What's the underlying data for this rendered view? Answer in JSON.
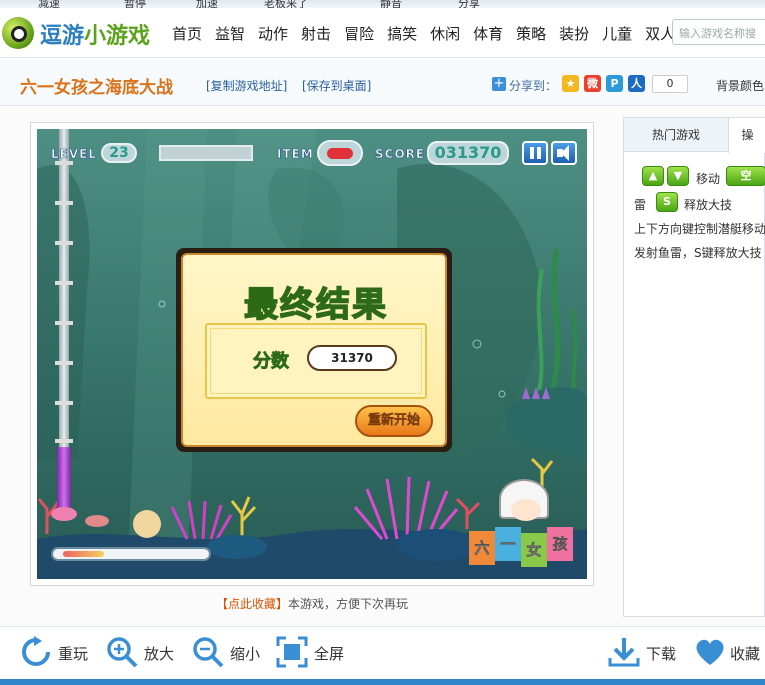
{
  "browser_strip": [
    "减速",
    "暂停",
    "加速",
    "老板来了",
    "静音",
    "分享"
  ],
  "logo": {
    "part1": "逗游",
    "part2": "小游戏"
  },
  "nav": [
    "首页",
    "益智",
    "动作",
    "射击",
    "冒险",
    "搞笑",
    "休闲",
    "体育",
    "策略",
    "装扮",
    "儿童",
    "双人"
  ],
  "search": {
    "placeholder": "输入游戏名称搜"
  },
  "titlebar": {
    "game_title": "六一女孩之海底大战",
    "copy_link": "[复制游戏地址]",
    "save_desktop": "[保存到桌面]",
    "share_label": "分享到：",
    "share_count": "0",
    "bg_color_label": "背景颜色"
  },
  "game": {
    "hud": {
      "level_label": "LEVEL",
      "level_value": "23",
      "item_label": "ITEM",
      "score_label": "SCORE",
      "score_value": "031370"
    },
    "dialog": {
      "title": "最终结果",
      "score_label": "分数",
      "score_value": "31370",
      "restart": "重新开始"
    },
    "brand": [
      "六",
      "一",
      "女",
      "孩"
    ],
    "depth_bar": 0.3,
    "colors": {
      "water": "#3f7d72",
      "hud_blue": "#1d5fb0",
      "dialog_bg": "#fff6c8"
    }
  },
  "caption": {
    "highlight": "【点此收藏】",
    "text": "本游戏，方便下次再玩"
  },
  "side": {
    "tabs": [
      "热门游戏",
      "操"
    ],
    "move_label": "移动",
    "space_key": "空",
    "mine_label": "雷",
    "s_key": "S",
    "skill_label": "释放大技",
    "desc_line1": "上下方向键控制潜艇移动",
    "desc_line2": "发射鱼雷，S键释放大技"
  },
  "bottom": {
    "replay": "重玩",
    "zoom_in": "放大",
    "zoom_out": "缩小",
    "fullscreen": "全屏",
    "download": "下载",
    "favorite": "收藏"
  }
}
